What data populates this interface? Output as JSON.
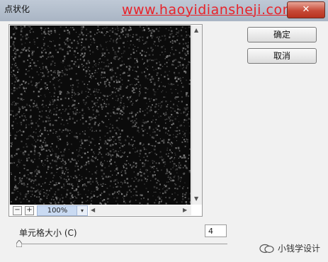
{
  "window": {
    "title": "点状化",
    "watermark": "www.haoyidiansheji.com",
    "close_glyph": "✕"
  },
  "preview": {
    "zoom_out_glyph": "−",
    "zoom_in_glyph": "+",
    "zoom_value": "100%",
    "zoom_dropdown_glyph": "▾",
    "scroll_up_glyph": "▲",
    "scroll_down_glyph": "▼",
    "scroll_left_glyph": "◀",
    "scroll_right_glyph": "▶"
  },
  "buttons": {
    "ok_label": "确定",
    "cancel_label": "取消"
  },
  "cell_size": {
    "label": "单元格大小 (C)",
    "value": "4",
    "slider_position": 0.0
  },
  "branding": {
    "text": "小钱学设计",
    "icon": "wechat-icon"
  },
  "colors": {
    "preview_bg": "#0b0b0b",
    "close_red": "#c74a38",
    "watermark_red": "#e8232a",
    "zoom_highlight": "#c9daf2"
  }
}
